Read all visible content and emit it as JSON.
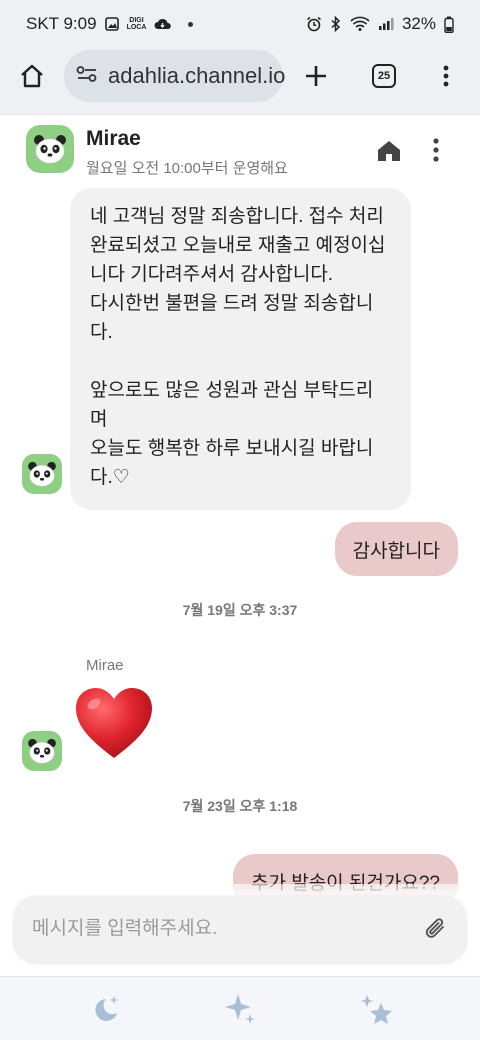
{
  "status_bar": {
    "carrier_time": "SKT 9:09",
    "digi_line1": "DIGI",
    "digi_line2": "LOCA",
    "battery": "32%"
  },
  "browser": {
    "url": "adahlia.channel.io",
    "tab_count": "25"
  },
  "chat": {
    "name": "Mirae",
    "hours": "월요일 오전 10:00부터 운영해요"
  },
  "messages": {
    "agent_1_lines": [
      "네 고객님 정말 죄송합니다. 접수 처리",
      "완료되셨고 오늘내로 재출고 예정이십",
      "니다 기다려주셔서 감사합니다.",
      "다시한번 불편을 드려 정말 죄송합니",
      "다.",
      "",
      "앞으로도 많은 성원과 관심 부탁드리",
      "며",
      "오늘도 행복한 하루 보내시길 바랍니",
      "다.♡"
    ],
    "user_1": "감사합니다",
    "date_1": "7월 19일 오후 3:37",
    "agent_2_sender": "Mirae",
    "agent_2_emoji": "heart",
    "date_2": "7월 23일 오후 1:18",
    "user_2": "추가 발송이 된건가요??"
  },
  "composer": {
    "placeholder": "메시지를 입력해주세요."
  },
  "icons": {
    "moon": "moon-sparkle-icon",
    "sparkle": "sparkles-icon",
    "stars": "stars-icon"
  },
  "colors": {
    "avatar_bg": "#8fcf83",
    "incoming_bubble": "#f1f1f2",
    "outgoing_bubble": "#e9c9ca",
    "heart": "#e0242e",
    "nav_icon": "#a9bfd8"
  }
}
